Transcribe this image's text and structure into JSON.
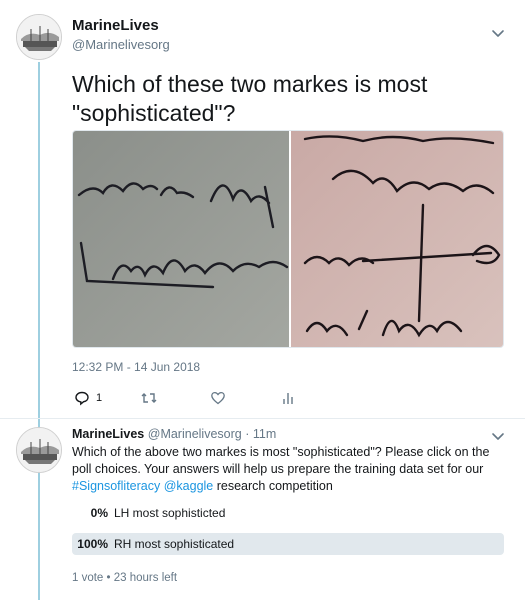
{
  "tweet": {
    "author_name": "MarineLives",
    "author_handle": "@Marinelivesorg",
    "text": "Which of these two markes is most \"sophisticated\"?",
    "timestamp": "12:32 PM - 14 Jun 2018",
    "replies_count": "1"
  },
  "reply": {
    "author_name": "MarineLives",
    "author_handle": "@Marinelivesorg",
    "separator": "·",
    "age": "11m",
    "text_part1": "Which of the above two markes is most \"sophisticated\"? Please click on the poll choices. Your answers will help us prepare the training data set for our ",
    "link1": "#Signsofliteracy",
    "link2": "@kaggle",
    "text_part2": " research competition",
    "poll": {
      "options": [
        {
          "percent": "0%",
          "label": "LH most sophisticted",
          "winner": false
        },
        {
          "percent": "100%",
          "label": "RH most sophisticated",
          "winner": true
        }
      ],
      "meta": "1 vote • 23 hours left"
    }
  },
  "colors": {
    "thread_line": "#9ecfe0",
    "link": "#1b95e0",
    "secondary_text": "#657786",
    "poll_winner_bg": "#e1e8ed"
  }
}
